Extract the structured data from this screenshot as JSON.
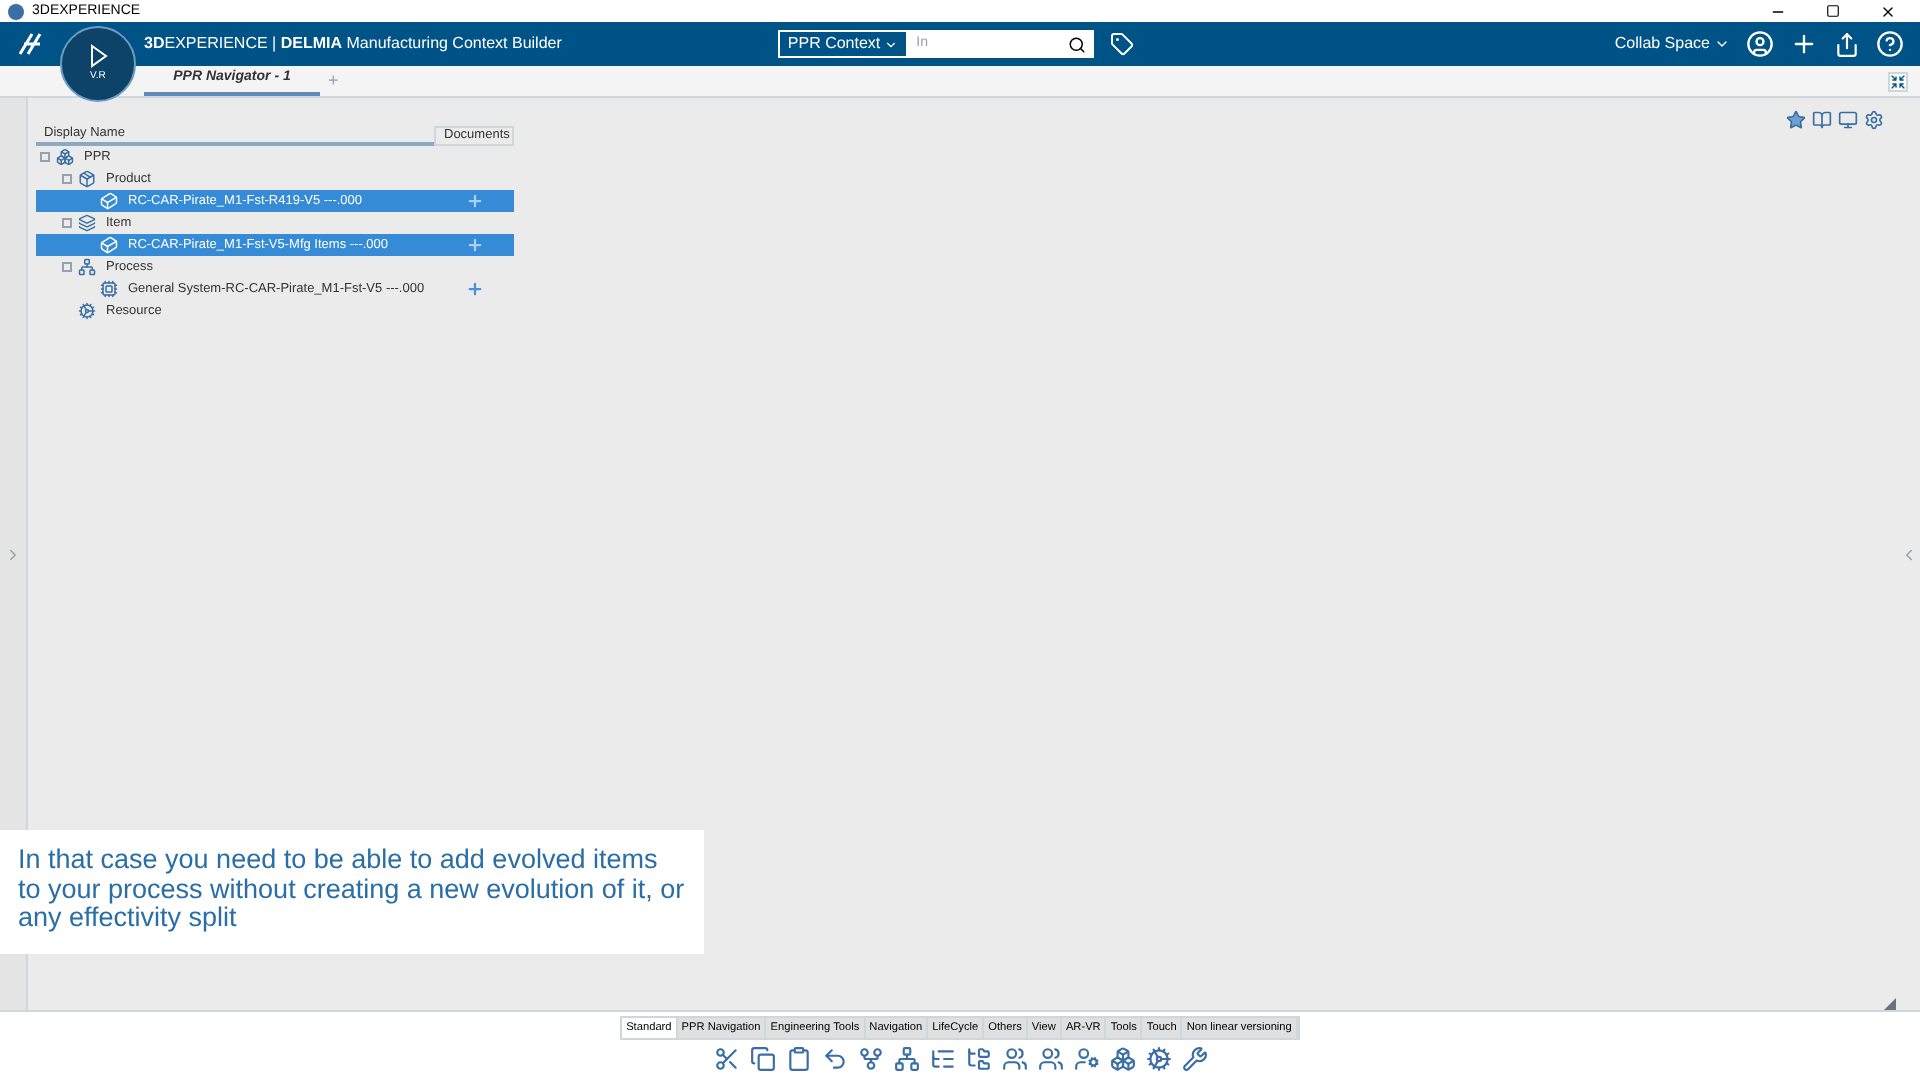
{
  "window": {
    "title": "3DEXPERIENCE"
  },
  "header": {
    "brand_bold": "3D",
    "brand_rest": "EXPERIENCE",
    "separator": "|",
    "app_brand": "DELMIA",
    "app_name": "Manufacturing Context Builder",
    "compass_label": "V.R",
    "search_scope": "PPR Context",
    "search_placeholder": "In",
    "collab_space": "Collab Space"
  },
  "tabs": [
    {
      "label": "PPR Navigator - 1",
      "selected": true
    }
  ],
  "add_tab": "+",
  "tree": {
    "columns": [
      "Display Name",
      "Documents"
    ],
    "items": [
      {
        "label": "PPR",
        "kind": "ppr",
        "selected": false,
        "has_document": false,
        "children": [
          {
            "label": "Product",
            "kind": "product",
            "selected": false,
            "has_document": false,
            "children": [
              {
                "label": "RC-CAR-Pirate_M1-Fst-R419-V5 ---.000",
                "kind": "part",
                "selected": true,
                "has_document": true
              }
            ]
          },
          {
            "label": "Item",
            "kind": "item",
            "selected": false,
            "has_document": false,
            "children": [
              {
                "label": "RC-CAR-Pirate_M1-Fst-V5-Mfg Items ---.000",
                "kind": "part",
                "selected": true,
                "has_document": true
              }
            ]
          },
          {
            "label": "Process",
            "kind": "process",
            "selected": false,
            "has_document": false,
            "children": [
              {
                "label": "General System-RC-CAR-Pirate_M1-Fst-V5 ---.000",
                "kind": "system",
                "selected": false,
                "has_document": true
              }
            ]
          },
          {
            "label": "Resource",
            "kind": "resource",
            "selected": false,
            "has_document": false
          }
        ]
      }
    ]
  },
  "caption": "In that case you need to be able to add evolved items to your process without creating a new evolution of it, or any effectivity split",
  "toolbar_tabs": [
    {
      "label": "Standard",
      "selected": true
    },
    {
      "label": "PPR Navigation",
      "selected": false
    },
    {
      "label": "Engineering Tools",
      "selected": false
    },
    {
      "label": "Navigation",
      "selected": false
    },
    {
      "label": "LifeCycle",
      "selected": false
    },
    {
      "label": "Others",
      "selected": false
    },
    {
      "label": "View",
      "selected": false
    },
    {
      "label": "AR-VR",
      "selected": false
    },
    {
      "label": "Tools",
      "selected": false
    },
    {
      "label": "Touch",
      "selected": false
    },
    {
      "label": "Non linear versioning",
      "selected": false
    }
  ]
}
